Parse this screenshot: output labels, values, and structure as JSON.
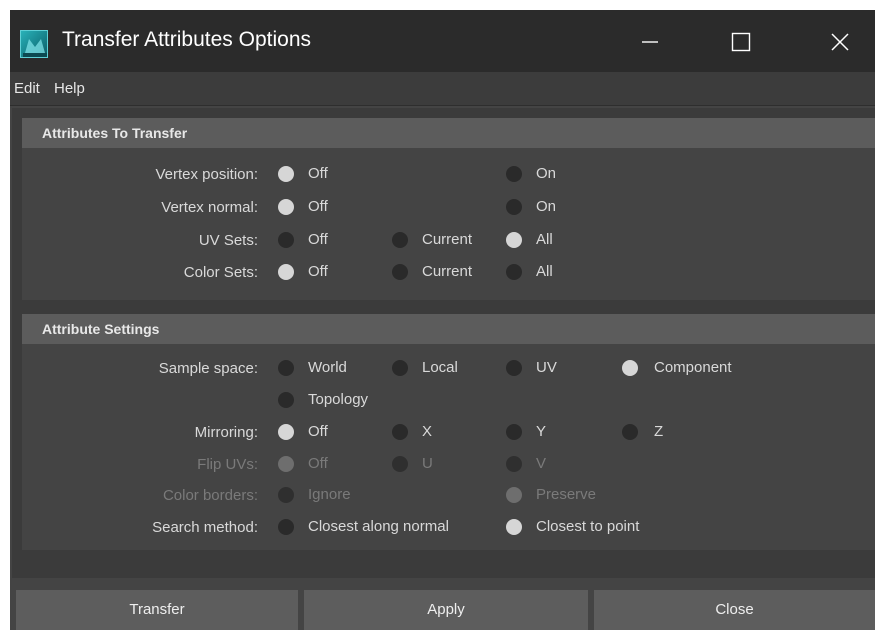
{
  "window": {
    "title": "Transfer Attributes Options",
    "icon": "maya-app-icon"
  },
  "menu": [
    "Edit",
    "Help"
  ],
  "sections": {
    "attributes_to_transfer": {
      "header": "Attributes To Transfer",
      "rows": {
        "vertex_position": {
          "label": "Vertex position:",
          "options": [
            "Off",
            "On"
          ],
          "selected": "Off"
        },
        "vertex_normal": {
          "label": "Vertex normal:",
          "options": [
            "Off",
            "On"
          ],
          "selected": "Off"
        },
        "uv_sets": {
          "label": "UV Sets:",
          "options": [
            "Off",
            "Current",
            "All"
          ],
          "selected": "All"
        },
        "color_sets": {
          "label": "Color Sets:",
          "options": [
            "Off",
            "Current",
            "All"
          ],
          "selected": "Off"
        }
      }
    },
    "attribute_settings": {
      "header": "Attribute Settings",
      "rows": {
        "sample_space": {
          "label": "Sample space:",
          "options": [
            "World",
            "Local",
            "UV",
            "Component",
            "Topology"
          ],
          "selected": "Component"
        },
        "mirroring": {
          "label": "Mirroring:",
          "options": [
            "Off",
            "X",
            "Y",
            "Z"
          ],
          "selected": "Off"
        },
        "flip_uvs": {
          "label": "Flip UVs:",
          "options": [
            "Off",
            "U",
            "V"
          ],
          "selected": "Off",
          "disabled": true
        },
        "color_borders": {
          "label": "Color borders:",
          "options": [
            "Ignore",
            "Preserve"
          ],
          "selected": "Preserve",
          "disabled": true
        },
        "search_method": {
          "label": "Search method:",
          "options": [
            "Closest along normal",
            "Closest to point"
          ],
          "selected": "Closest to point"
        }
      }
    }
  },
  "buttons": {
    "transfer": "Transfer",
    "apply": "Apply",
    "close": "Close"
  },
  "colors": {
    "title_bar": "#2b2b2b",
    "panel": "#444444",
    "section_header": "#5c5c5c",
    "radio_selected": "#d6d6d6",
    "radio_unselected": "#2a2a2a"
  }
}
